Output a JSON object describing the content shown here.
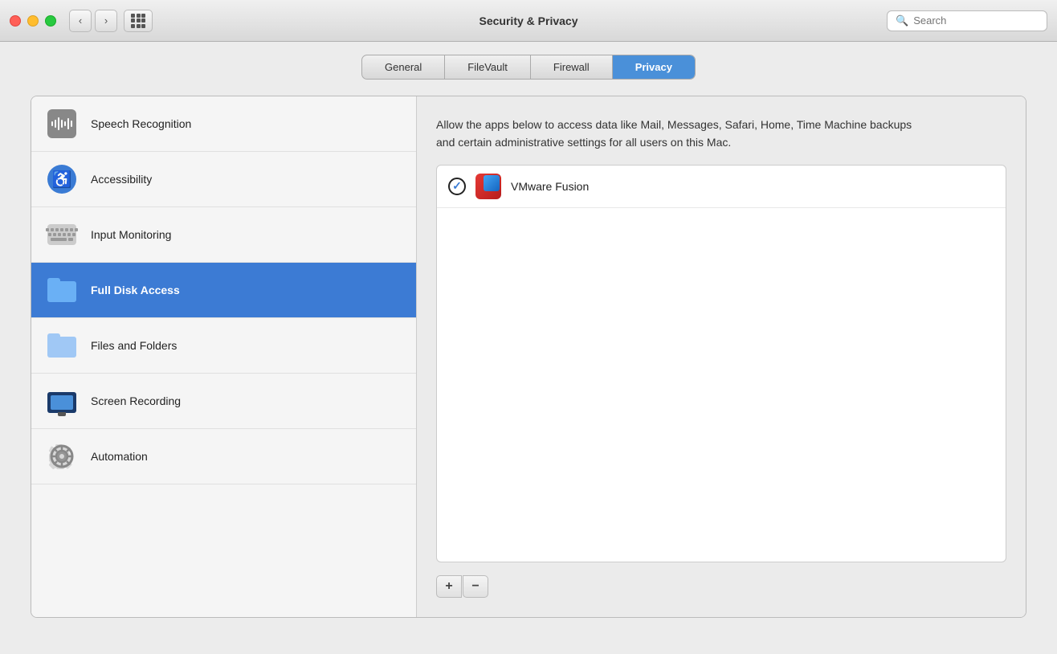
{
  "titlebar": {
    "title": "Security & Privacy",
    "search_placeholder": "Search"
  },
  "tabs": [
    {
      "id": "general",
      "label": "General",
      "active": false
    },
    {
      "id": "filevault",
      "label": "FileVault",
      "active": false
    },
    {
      "id": "firewall",
      "label": "Firewall",
      "active": false
    },
    {
      "id": "privacy",
      "label": "Privacy",
      "active": true
    }
  ],
  "sidebar": {
    "items": [
      {
        "id": "speech-recognition",
        "label": "Speech Recognition",
        "active": false,
        "icon": "speech-recognition-icon"
      },
      {
        "id": "accessibility",
        "label": "Accessibility",
        "active": false,
        "icon": "accessibility-icon"
      },
      {
        "id": "input-monitoring",
        "label": "Input Monitoring",
        "active": false,
        "icon": "keyboard-icon"
      },
      {
        "id": "full-disk-access",
        "label": "Full Disk Access",
        "active": true,
        "icon": "folder-icon"
      },
      {
        "id": "files-and-folders",
        "label": "Files and Folders",
        "active": false,
        "icon": "folder-light-icon"
      },
      {
        "id": "screen-recording",
        "label": "Screen Recording",
        "active": false,
        "icon": "screen-recording-icon"
      },
      {
        "id": "automation",
        "label": "Automation",
        "active": false,
        "icon": "gear-icon"
      }
    ]
  },
  "right_panel": {
    "description": "Allow the apps below to access data like Mail, Messages, Safari, Home, Time Machine backups and certain administrative settings for all users on this Mac.",
    "apps": [
      {
        "id": "vmware-fusion",
        "name": "VMware Fusion",
        "checked": true
      }
    ],
    "add_button_label": "+",
    "remove_button_label": "−"
  }
}
